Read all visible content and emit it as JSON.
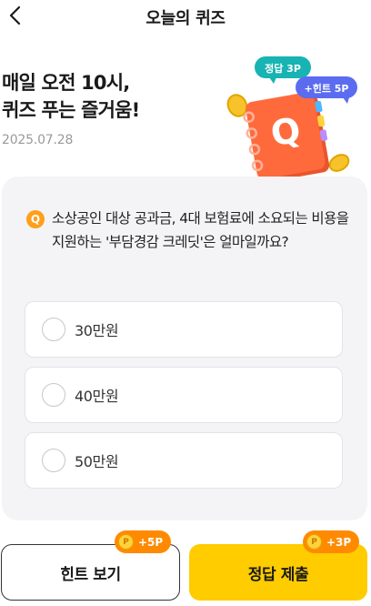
{
  "header": {
    "title": "오늘의 퀴즈"
  },
  "hero": {
    "headline_line1": "매일 오전 10시,",
    "headline_line2": "퀴즈 푸는 즐거움!",
    "date": "2025.07.28",
    "bubble_answer": "정답 3P",
    "bubble_hint": "+힌트 5P",
    "book_letter": "Q"
  },
  "quiz": {
    "badge": "Q",
    "question": "소상공인 대상 공과금, 4대 보험료에 소요되는 비용을 지원하는 '부담경감 크레딧'은 얼마일까요?",
    "options": [
      {
        "label": "30만원"
      },
      {
        "label": "40만원"
      },
      {
        "label": "50만원"
      }
    ]
  },
  "actions": {
    "hint_label": "힌트 보기",
    "hint_points": "+5P",
    "submit_label": "정답 제출",
    "submit_points": "+3P",
    "coin_glyph": "P"
  },
  "colors": {
    "accent_yellow": "#ffcc00",
    "badge_orange": "#ff8a00",
    "bubble_teal": "#18b3b3",
    "bubble_blue": "#5b6cf0",
    "book_orange": "#ff6a3d"
  }
}
